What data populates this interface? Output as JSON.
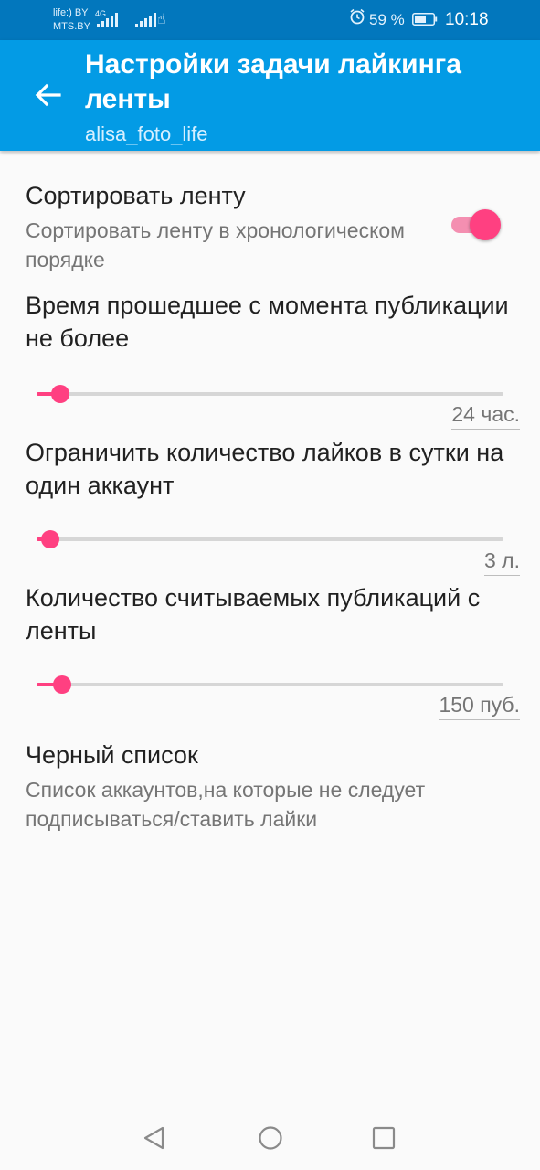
{
  "status_bar": {
    "carrier_1": "life:) BY",
    "carrier_2": "MTS.BY",
    "network_tag": "4G",
    "battery_percent": "59 %",
    "time": "10:18",
    "icons": [
      "signal-icon",
      "signal-icon",
      "touch-icon",
      "alarm-icon",
      "battery-icon"
    ]
  },
  "app_bar": {
    "title": "Настройки задачи лайкинга ленты",
    "subtitle": "alisa_foto_life",
    "back_icon": "arrow-back-icon"
  },
  "prefs": {
    "sort_feed": {
      "title": "Сортировать ленту",
      "summary": "Сортировать ленту в хронологическом порядке",
      "enabled": true
    },
    "max_age": {
      "title": "Время прошедшее с момента публикации не более",
      "value_text": "24 час.",
      "level": 0.05
    },
    "likes_limit": {
      "title": "Ограничить количество лайков в сутки на один аккаунт",
      "value_text": "3 л.",
      "level": 0.03
    },
    "posts_count": {
      "title": "Количество считываемых публикаций с ленты",
      "value_text": "150 пуб.",
      "level": 0.055
    },
    "blacklist": {
      "title": "Черный список",
      "summary": "Список аккаунтов,на которые не следует подписываться/ставить лайки"
    }
  },
  "nav_bar": {
    "icons": [
      "back-triangle-icon",
      "home-circle-icon",
      "recents-square-icon"
    ]
  },
  "colors": {
    "status_bar": "#0277bd",
    "app_bar": "#039be5",
    "accent": "#ff4081",
    "background": "#fafafa"
  }
}
